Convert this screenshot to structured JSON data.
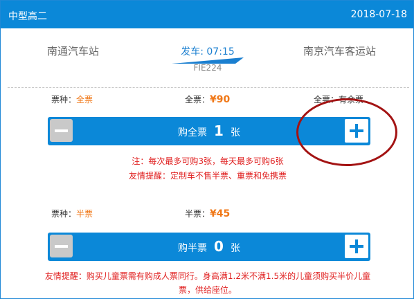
{
  "header": {
    "title": "中型高二",
    "date": "2018-07-18"
  },
  "route": {
    "from": "南通汽车站",
    "to": "南京汽车客运站",
    "depart": "发车: 07:15",
    "train_no": "FIE224"
  },
  "full_ticket": {
    "type_label": "票种：",
    "type_value": "全票",
    "price_label": "全票：",
    "price_value": "¥90",
    "stock_label": "全票：",
    "stock_value": "有余票",
    "buy_prefix": "购全票",
    "count": "1",
    "unit": "张",
    "note1": "注：每次最多可购3张，每天最多可购6张",
    "note2": "友情提醒：定制车不售半票、重票和免携票"
  },
  "half_ticket": {
    "type_label": "票种：",
    "type_value": "半票",
    "price_label": "半票：",
    "price_value": "¥45",
    "buy_prefix": "购半票",
    "count": "0",
    "unit": "张",
    "note1": "友情提醒：购买儿童票需有购成人票同行。身高满1.2米不满1.5米的儿童须购买半价儿童",
    "note2": "票，供给座位。"
  },
  "colors": {
    "accent": "#0b88d8",
    "price": "#f07818",
    "warning": "#e02020",
    "annotation": "#a31313"
  }
}
